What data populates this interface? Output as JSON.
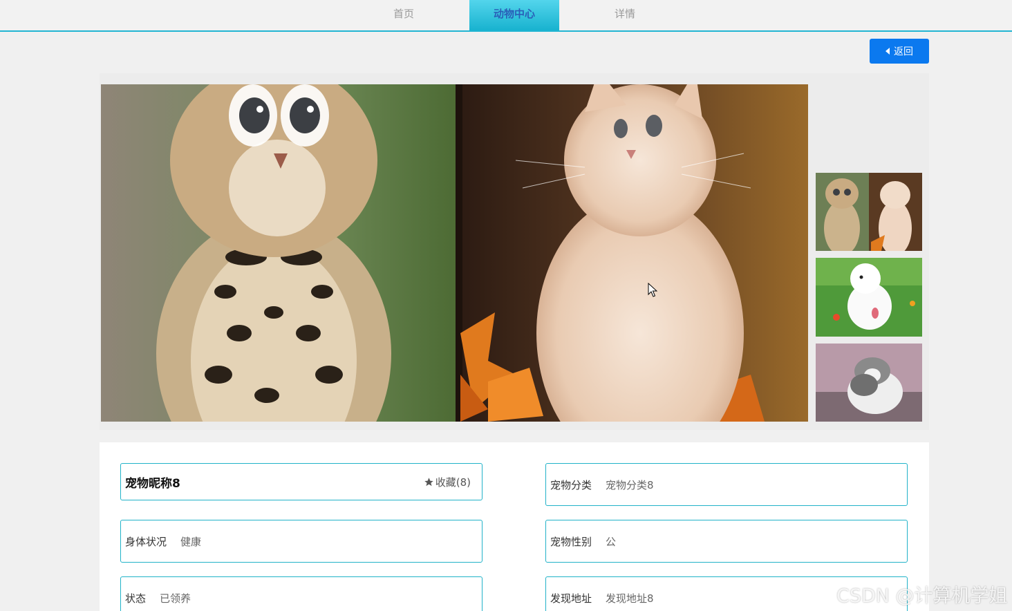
{
  "nav": {
    "home": "首页",
    "animal_center": "动物中心",
    "detail": "详情"
  },
  "back_button": {
    "label": "返回"
  },
  "gallery": {
    "main_image": "two-kittens-photo",
    "thumbnails": [
      "two-kittens-photo",
      "white-puppy-on-grass",
      "grey-white-cat"
    ]
  },
  "pet": {
    "name": "宠物昵称8",
    "favorite_label": "收藏(8)",
    "fields": {
      "category": {
        "label": "宠物分类",
        "value": "宠物分类8"
      },
      "health": {
        "label": "身体状况",
        "value": "健康"
      },
      "gender": {
        "label": "宠物性别",
        "value": "公"
      },
      "status": {
        "label": "状态",
        "value": "已领养"
      },
      "address": {
        "label": "发现地址",
        "value": "发现地址8"
      }
    }
  },
  "watermark": "CSDN @计算机学姐",
  "colors": {
    "accent": "#21b5d2",
    "button": "#0b79ef",
    "active_tab_text": "#2a5fb8"
  }
}
